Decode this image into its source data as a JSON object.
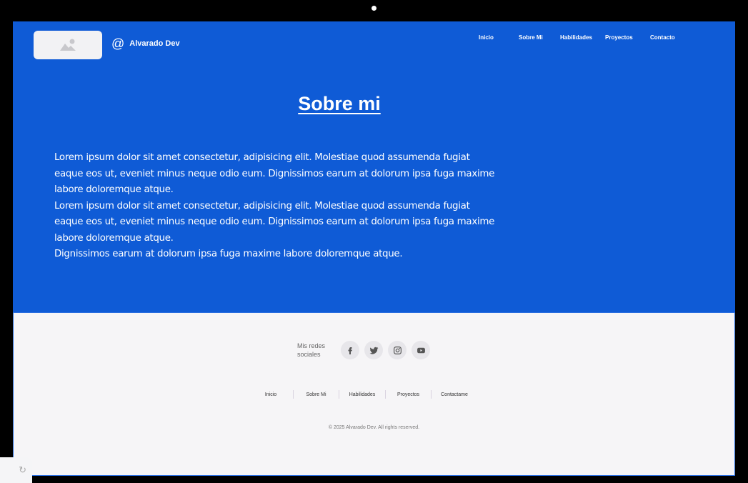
{
  "header": {
    "brand_name": "Alvarado Dev",
    "nav": [
      "Inicio",
      "Sobre Mi",
      "Habilidades",
      "Proyectos",
      "Contacto"
    ]
  },
  "hero": {
    "title": "Sobre mi",
    "paragraphs": [
      "Lorem ipsum dolor sit amet consectetur, adipisicing elit. Molestiae quod assumenda fugiat eaque eos ut, eveniet minus neque odio eum. Dignissimos earum at dolorum ipsa fuga maxime labore doloremque atque.",
      "Lorem ipsum dolor sit amet consectetur, adipisicing elit. Molestiae quod assumenda fugiat eaque eos ut, eveniet minus neque odio eum. Dignissimos earum at dolorum ipsa fuga maxime labore doloremque atque.",
      "Dignissimos earum at dolorum ipsa fuga maxime labore doloremque atque."
    ]
  },
  "footer": {
    "social_label": "Mis redes sociales",
    "social_icons": [
      "facebook-icon",
      "twitter-icon",
      "instagram-icon",
      "youtube-icon"
    ],
    "nav": [
      "Inicio",
      "Sobre Mi",
      "Habilidades",
      "Proyectos",
      "Contactame"
    ],
    "copyright": "© 2025 Alvarado Dev. All rights reserved."
  },
  "colors": {
    "primary": "#0f5bd6",
    "footer_bg": "#f6f5f7"
  }
}
